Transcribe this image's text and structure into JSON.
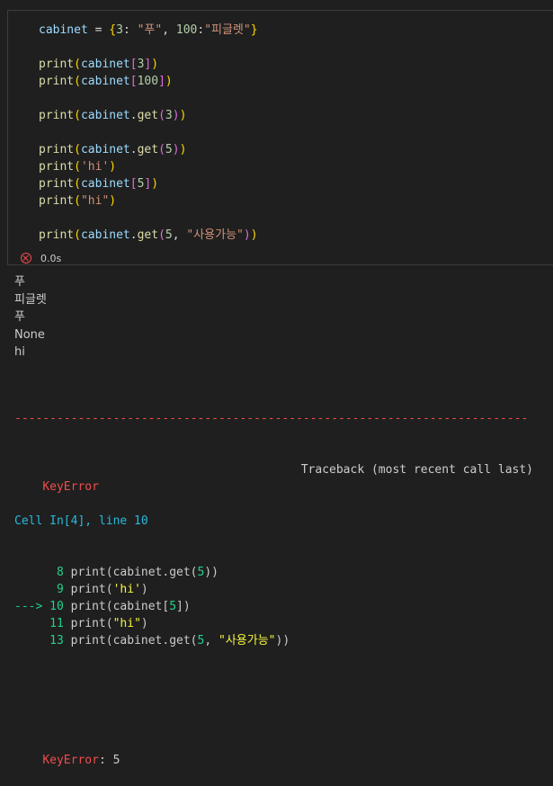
{
  "code_cell": {
    "lines": [
      [
        {
          "t": "cabinet",
          "c": "var"
        },
        {
          "t": " = ",
          "c": "op"
        },
        {
          "t": "{",
          "c": "p1"
        },
        {
          "t": "3",
          "c": "num"
        },
        {
          "t": ": ",
          "c": "op"
        },
        {
          "t": "\"푸\"",
          "c": "str"
        },
        {
          "t": ", ",
          "c": "op"
        },
        {
          "t": "100",
          "c": "num"
        },
        {
          "t": ":",
          "c": "op"
        },
        {
          "t": "\"피글렛\"",
          "c": "str"
        },
        {
          "t": "}",
          "c": "p1"
        }
      ],
      [],
      [
        {
          "t": "print",
          "c": "fn"
        },
        {
          "t": "(",
          "c": "p1"
        },
        {
          "t": "cabinet",
          "c": "var"
        },
        {
          "t": "[",
          "c": "p2"
        },
        {
          "t": "3",
          "c": "num"
        },
        {
          "t": "]",
          "c": "p2"
        },
        {
          "t": ")",
          "c": "p1"
        }
      ],
      [
        {
          "t": "print",
          "c": "fn"
        },
        {
          "t": "(",
          "c": "p1"
        },
        {
          "t": "cabinet",
          "c": "var"
        },
        {
          "t": "[",
          "c": "p2"
        },
        {
          "t": "100",
          "c": "num"
        },
        {
          "t": "]",
          "c": "p2"
        },
        {
          "t": ")",
          "c": "p1"
        }
      ],
      [],
      [
        {
          "t": "print",
          "c": "fn"
        },
        {
          "t": "(",
          "c": "p1"
        },
        {
          "t": "cabinet",
          "c": "var"
        },
        {
          "t": ".",
          "c": "op"
        },
        {
          "t": "get",
          "c": "fn"
        },
        {
          "t": "(",
          "c": "p2"
        },
        {
          "t": "3",
          "c": "num"
        },
        {
          "t": ")",
          "c": "p2"
        },
        {
          "t": ")",
          "c": "p1"
        }
      ],
      [],
      [
        {
          "t": "print",
          "c": "fn"
        },
        {
          "t": "(",
          "c": "p1"
        },
        {
          "t": "cabinet",
          "c": "var"
        },
        {
          "t": ".",
          "c": "op"
        },
        {
          "t": "get",
          "c": "fn"
        },
        {
          "t": "(",
          "c": "p2"
        },
        {
          "t": "5",
          "c": "num"
        },
        {
          "t": ")",
          "c": "p2"
        },
        {
          "t": ")",
          "c": "p1"
        }
      ],
      [
        {
          "t": "print",
          "c": "fn"
        },
        {
          "t": "(",
          "c": "p1"
        },
        {
          "t": "'hi'",
          "c": "str"
        },
        {
          "t": ")",
          "c": "p1"
        }
      ],
      [
        {
          "t": "print",
          "c": "fn"
        },
        {
          "t": "(",
          "c": "p1"
        },
        {
          "t": "cabinet",
          "c": "var"
        },
        {
          "t": "[",
          "c": "p2"
        },
        {
          "t": "5",
          "c": "num"
        },
        {
          "t": "]",
          "c": "p2"
        },
        {
          "t": ")",
          "c": "p1"
        }
      ],
      [
        {
          "t": "print",
          "c": "fn"
        },
        {
          "t": "(",
          "c": "p1"
        },
        {
          "t": "\"hi\"",
          "c": "str"
        },
        {
          "t": ")",
          "c": "p1"
        }
      ],
      [],
      [
        {
          "t": "print",
          "c": "fn"
        },
        {
          "t": "(",
          "c": "p1"
        },
        {
          "t": "cabinet",
          "c": "var"
        },
        {
          "t": ".",
          "c": "op"
        },
        {
          "t": "get",
          "c": "fn"
        },
        {
          "t": "(",
          "c": "p2"
        },
        {
          "t": "5",
          "c": "num"
        },
        {
          "t": ", ",
          "c": "op"
        },
        {
          "t": "\"사용가능\"",
          "c": "str"
        },
        {
          "t": ")",
          "c": "p2"
        },
        {
          "t": ")",
          "c": "p1"
        }
      ]
    ]
  },
  "status": {
    "icon": "error-circle-icon",
    "time": "0.0s"
  },
  "stdout": [
    "푸",
    "피글렛",
    "푸",
    "None",
    "hi"
  ],
  "traceback": {
    "separator": "-------------------------------------------------------------------------",
    "error_name": "KeyError",
    "header_right": "Traceback (most recent call last)",
    "cell_ref": "Cell In[4], line 10",
    "frames": [
      [
        {
          "t": "      8 ",
          "c": "green"
        },
        {
          "t": "print(cabinet.get(",
          "c": ""
        },
        {
          "t": "5",
          "c": "green"
        },
        {
          "t": "))",
          "c": ""
        }
      ],
      [
        {
          "t": "      9 ",
          "c": "green"
        },
        {
          "t": "print(",
          "c": ""
        },
        {
          "t": "'hi'",
          "c": "yellow"
        },
        {
          "t": ")",
          "c": ""
        }
      ],
      [
        {
          "t": "---> 10 ",
          "c": "green"
        },
        {
          "t": "print(cabinet[",
          "c": ""
        },
        {
          "t": "5",
          "c": "green"
        },
        {
          "t": "])",
          "c": ""
        }
      ],
      [
        {
          "t": "     11 ",
          "c": "green"
        },
        {
          "t": "print(",
          "c": ""
        },
        {
          "t": "\"hi\"",
          "c": "yellow"
        },
        {
          "t": ")",
          "c": ""
        }
      ],
      [
        {
          "t": "     13 ",
          "c": "green"
        },
        {
          "t": "print(cabinet.get(",
          "c": ""
        },
        {
          "t": "5",
          "c": "green"
        },
        {
          "t": ", ",
          "c": ""
        },
        {
          "t": "\"사용가능\"",
          "c": "yellow"
        },
        {
          "t": "))",
          "c": ""
        }
      ]
    ],
    "final_error_name": "KeyError",
    "final_error_msg": ": 5"
  },
  "colors": {
    "background": "#1f1f1f",
    "error": "#f14c4c",
    "line_number": "#23d18b",
    "string_highlight": "#f5f543"
  }
}
